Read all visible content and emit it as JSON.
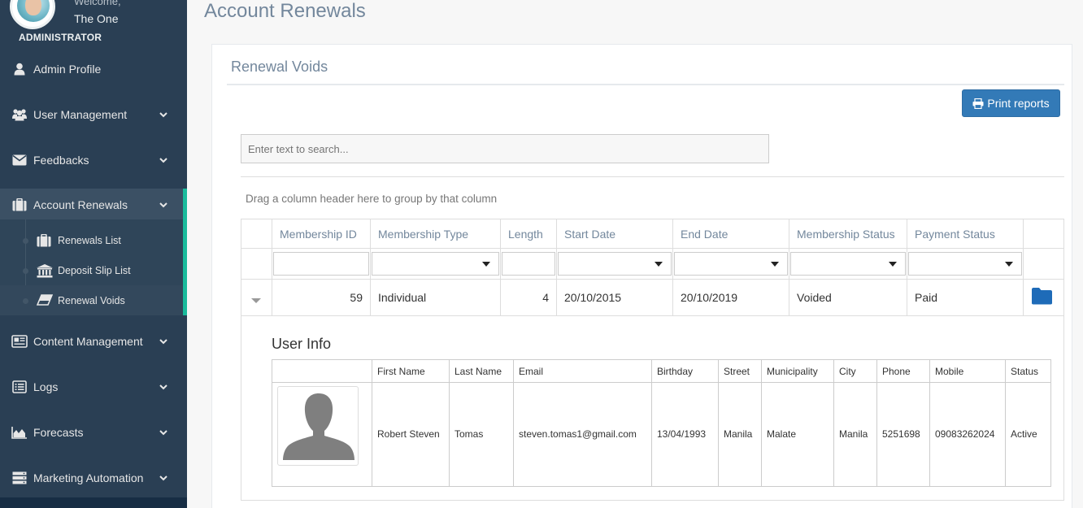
{
  "sidebar": {
    "welcome": "Welcome,",
    "username": "The One",
    "role": "ADMINISTRATOR",
    "items": [
      {
        "label": "Admin Profile",
        "icon": "user-icon"
      },
      {
        "label": "User Management",
        "icon": "users-icon"
      },
      {
        "label": "Feedbacks",
        "icon": "envelope-icon"
      },
      {
        "label": "Account Renewals",
        "icon": "briefcase-icon"
      },
      {
        "label": "Content Management",
        "icon": "newspaper-icon"
      },
      {
        "label": "Logs",
        "icon": "list-icon"
      },
      {
        "label": "Forecasts",
        "icon": "area-chart-icon"
      },
      {
        "label": "Marketing Automation",
        "icon": "server-icon"
      }
    ],
    "subitems": [
      {
        "label": "Renewals List",
        "icon": "briefcase-icon"
      },
      {
        "label": "Deposit Slip List",
        "icon": "bank-icon"
      },
      {
        "label": "Renewal Voids",
        "icon": "eraser-icon"
      }
    ]
  },
  "page": {
    "title": "Account Renewals",
    "panel_title": "Renewal Voids",
    "print_label": "Print reports",
    "search_placeholder": "Enter text to search...",
    "group_hint": "Drag a column header here to group by that column"
  },
  "grid": {
    "headers": [
      "Membership ID",
      "Membership Type",
      "Length",
      "Start Date",
      "End Date",
      "Membership Status",
      "Payment Status"
    ],
    "row": {
      "membership_id": "59",
      "membership_type": "Individual",
      "length": "4",
      "start_date": "20/10/2015",
      "end_date": "20/10/2019",
      "membership_status": "Voided",
      "payment_status": "Paid"
    }
  },
  "user_info": {
    "title": "User Info",
    "headers": [
      "First Name",
      "Last Name",
      "Email",
      "Birthday",
      "Street",
      "Municipality",
      "City",
      "Phone",
      "Mobile",
      "Status"
    ],
    "row": {
      "first_name": "Robert Steven",
      "last_name": "Tomas",
      "email": "steven.tomas1@gmail.com",
      "birthday": "13/04/1993",
      "street": "Manila",
      "municipality": "Malate",
      "city": "Manila",
      "phone": "5251698",
      "mobile": "09083262024",
      "status": "Active"
    }
  },
  "colors": {
    "sidebar_bg": "#2a3f54",
    "accent": "#1abb9c",
    "primary_button": "#337ab7",
    "folder_icon": "#1e6bb8"
  }
}
